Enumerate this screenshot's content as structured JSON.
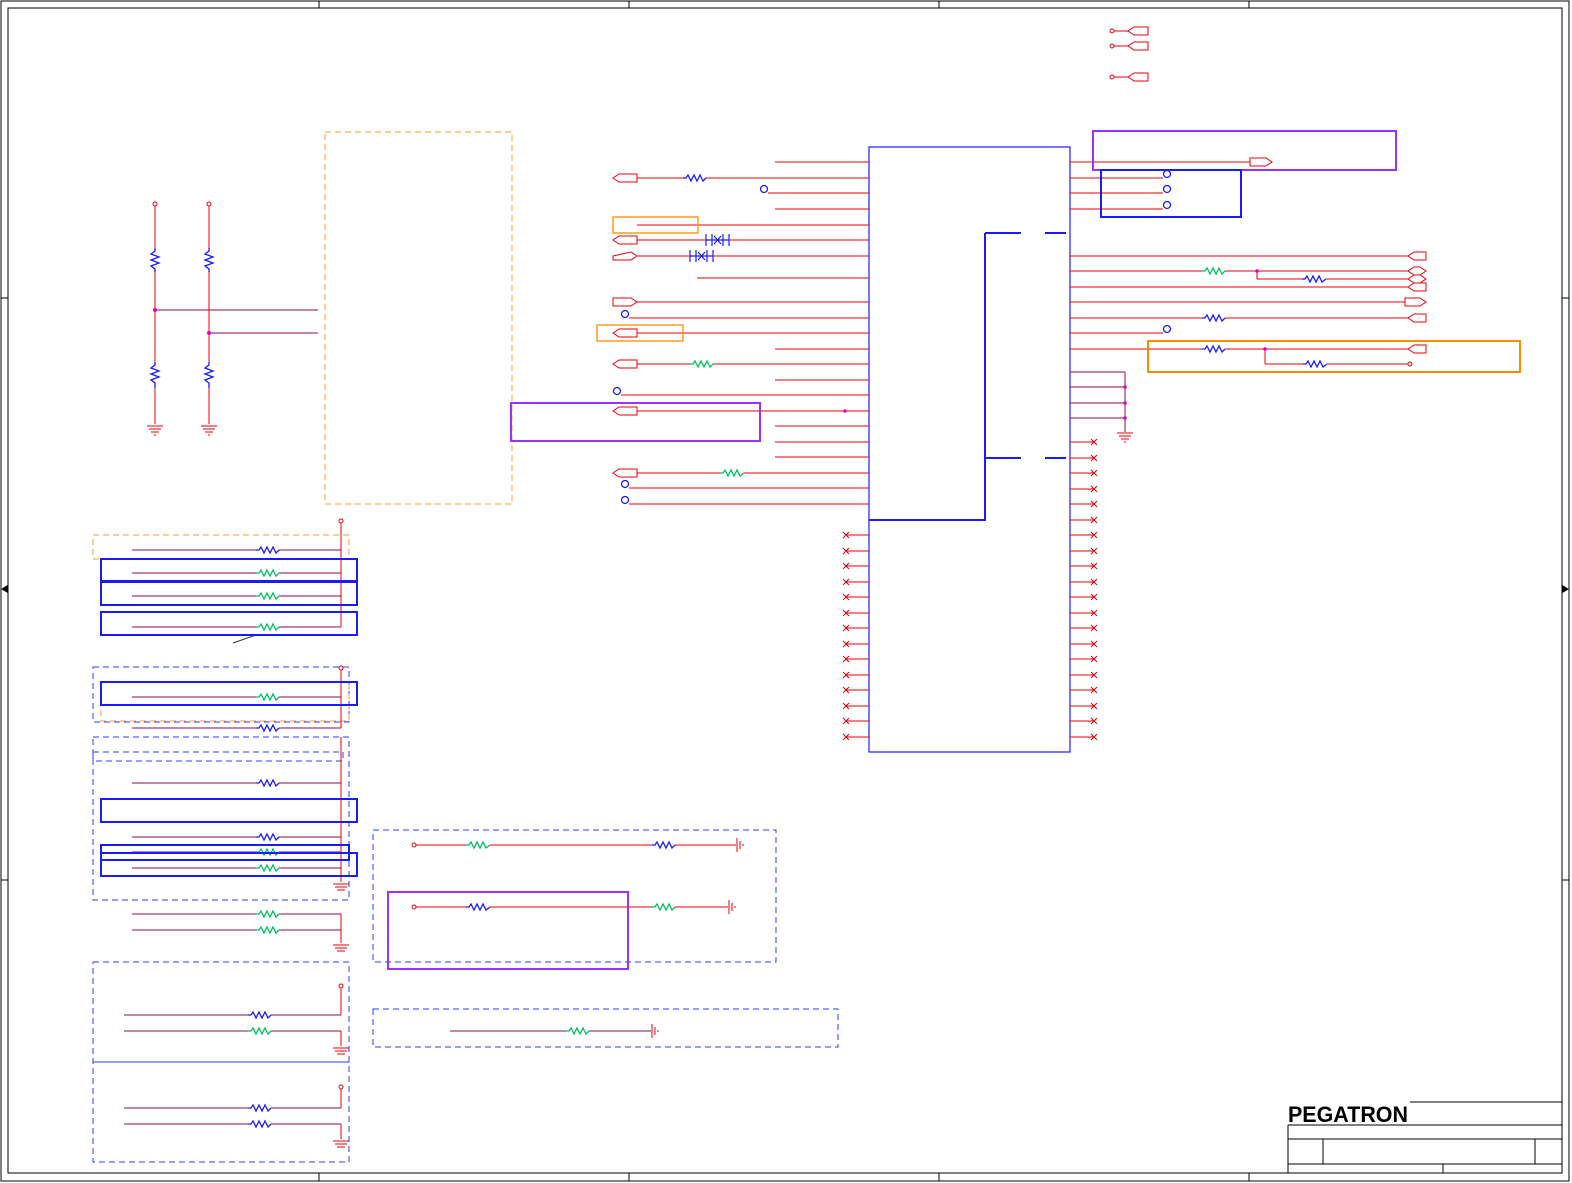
{
  "document": {
    "kind": "schematic-sheet",
    "brand": "PEGATRON"
  },
  "colors": {
    "frame": "#000000",
    "wire_red": "#e8000a",
    "wire_purple": "#8b0a50",
    "bus_blue": "#0000ee",
    "component_blue": "#1a1aff",
    "highlight_orange": "#ff8c00",
    "highlight_purple": "#9b30ff",
    "dashed_orange": "#ff9a2e",
    "dashed_blue": "#2b3cff",
    "resistor_green": "#00c060",
    "junction_magenta": "#e000c0"
  },
  "icons": [
    "resistor-icon",
    "ground-icon",
    "off-page-connector-icon",
    "test-point-icon",
    "no-connect-icon",
    "transistor-icon",
    "junction-dot-icon"
  ]
}
